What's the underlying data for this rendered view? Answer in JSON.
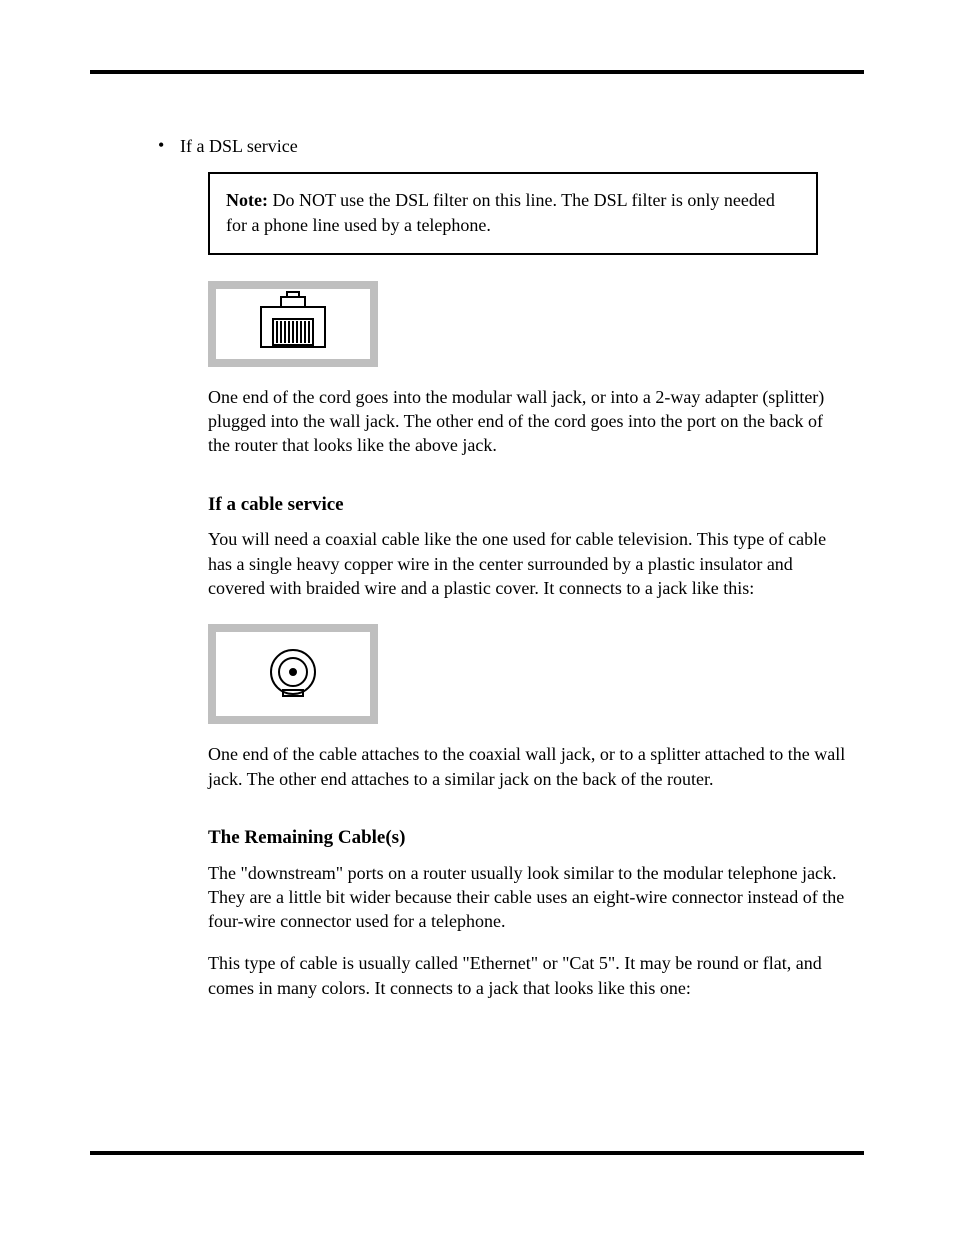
{
  "bullet1": "If a DSL service",
  "note": {
    "label": "Note:",
    "text": " Do NOT use the DSL filter on this line. The DSL filter is only needed for a phone line used by a telephone."
  },
  "icons": {
    "rj45": "rj45-port-icon",
    "coax": "coax-port-icon"
  },
  "para_rj45": "One end of the cord goes into the modular wall jack, or into a 2-way adapter (splitter) plugged into the wall jack. The other end of the cord goes into the port on the back of the router that looks like the above jack.",
  "title_cable": "If a cable service",
  "para_coax_intro": "You will need a coaxial cable like the one used for cable television. This type of cable has a single heavy copper wire in the center surrounded by a plastic insulator and covered with braided wire and a plastic cover. It connects to a jack like this:",
  "para_coax_use": "One end of the cable attaches to the coaxial wall jack, or to a splitter attached to the wall jack. The other end attaches to a similar jack on the back of the router.",
  "title_bottom": "The Remaining Cable(s)",
  "para_bottom_1": "The \"downstream\" ports on a router usually look similar to the modular telephone jack. They are a little bit wider because their cable uses an eight-wire connector instead of the four-wire connector used for a telephone.",
  "para_bottom_2": "This type of cable is usually called \"Ethernet\" or \"Cat 5\". It may be round or flat, and comes in many colors. It connects to a jack that looks like this one:"
}
